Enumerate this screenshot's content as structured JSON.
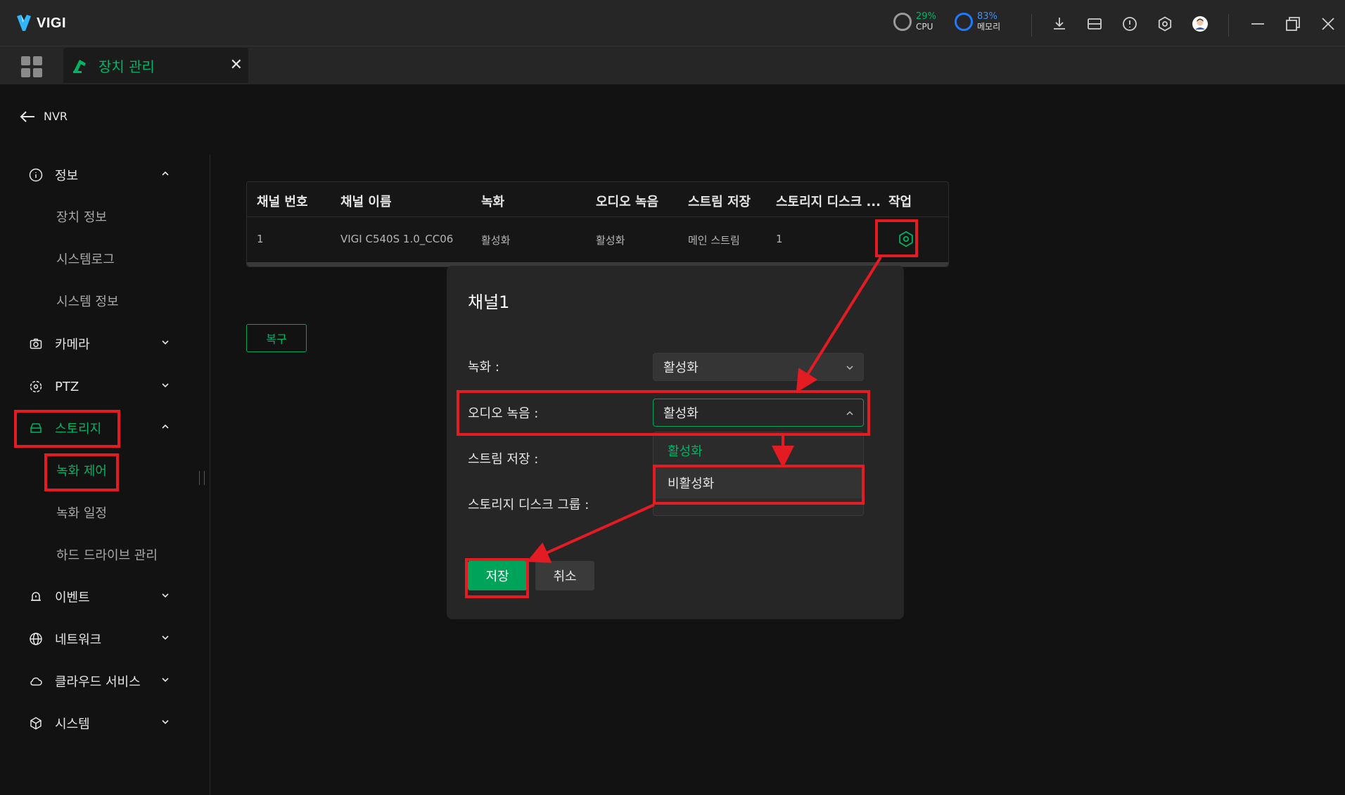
{
  "app": {
    "logo_text": "VIGI",
    "cpu": {
      "percent": "29%",
      "label": "CPU"
    },
    "memory": {
      "percent": "83%",
      "label": "메모리"
    },
    "toolbar_icons": [
      "download-icon",
      "folder-icon",
      "alert-icon",
      "settings-icon",
      "avatar",
      "minimize-icon",
      "restore-icon",
      "close-icon"
    ]
  },
  "tabs": [
    {
      "label": "장치 관리",
      "icon": "device-management-icon"
    }
  ],
  "sidebar": {
    "back_label": "NVR",
    "groups": [
      {
        "label": "정보",
        "icon": "info-icon",
        "expanded": true,
        "items": [
          "장치 정보",
          "시스템로그",
          "시스템 정보"
        ]
      },
      {
        "label": "카메라",
        "icon": "camera-icon",
        "expanded": false
      },
      {
        "label": "PTZ",
        "icon": "ptz-icon",
        "expanded": false
      },
      {
        "label": "스토리지",
        "icon": "storage-icon",
        "expanded": true,
        "items": [
          "녹화 제어",
          "녹화 일정",
          "하드 드라이브 관리"
        ]
      },
      {
        "label": "이벤트",
        "icon": "event-icon",
        "expanded": false
      },
      {
        "label": "네트워크",
        "icon": "network-icon",
        "expanded": false
      },
      {
        "label": "클라우드 서비스",
        "icon": "cloud-icon",
        "expanded": false
      },
      {
        "label": "시스템",
        "icon": "system-icon",
        "expanded": false
      }
    ]
  },
  "table": {
    "columns": [
      "채널 번호",
      "채널 이름",
      "녹화",
      "오디오 녹음",
      "스트림 저장",
      "스토리지 디스크 ...",
      "작업"
    ],
    "rows": [
      [
        "1",
        "VIGI C540S 1.0_CC06",
        "활성화",
        "활성화",
        "메인 스트림",
        "1",
        "settings-icon"
      ]
    ]
  },
  "restore_label": "복구",
  "dialog": {
    "title": "채널1",
    "fields": [
      {
        "label": "녹화 :",
        "value": "활성화"
      },
      {
        "label": "오디오 녹음 :",
        "value": "활성화"
      },
      {
        "label": "스트림 저장 :",
        "value": ""
      },
      {
        "label": "스토리지 디스크 그룹 :",
        "value": ""
      }
    ],
    "dropdown_options": [
      "활성화",
      "비활성화"
    ],
    "save_label": "저장",
    "cancel_label": "취소"
  },
  "colors": {
    "accent": "#00b464",
    "highlight": "#e31b23",
    "background": "#121212",
    "panel": "#262626"
  }
}
